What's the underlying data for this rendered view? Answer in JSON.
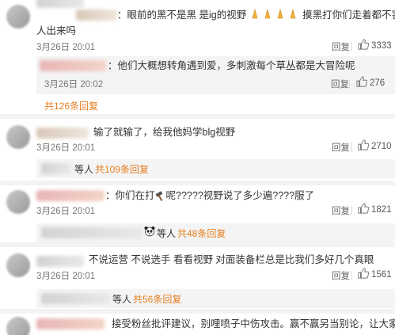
{
  "comments": [
    {
      "text_a": "：眼前的黑不是黑 是ig的视野",
      "text_b": "摸黑打你们走着都不害怕突然冒",
      "text_c": "人出来吗",
      "time": "3月26日 20:01",
      "reply_label": "回复",
      "likes": "3333",
      "sub_reply": {
        "text": "：他们大概想转角遇到爱，多刺激每个草丛都是大冒险呢",
        "time": "3月26日 20:02",
        "reply_label": "回复",
        "likes": "276"
      },
      "more_label": "共126条回复"
    },
    {
      "text": "输了就输了，给我他妈学blg视野",
      "time": "3月26日 20:01",
      "reply_label": "回复",
      "likes": "2710",
      "summary_prefix": "等人",
      "more_label": "共109条回复"
    },
    {
      "text_a": "：你们在打",
      "text_b": "呢?????视野说了多少遍????服了",
      "time": "3月26日 20:01",
      "reply_label": "回复",
      "likes": "1821",
      "summary_prefix": "等人",
      "more_label": "共48条回复"
    },
    {
      "text": "不说运营 不说选手 看看视野 对面装备栏总是比我们多好几个真眼",
      "time": "3月26日 20:01",
      "reply_label": "回复",
      "likes": "1561",
      "summary_prefix": "等人",
      "more_label": "共56条回复"
    },
    {
      "text": "接受粉丝批评建议，别哩喷子中伤攻击。赢不赢另当别论，让大家看到你们在"
    }
  ],
  "colors": {
    "more_link": "#e67e22",
    "background": "#f3f3f3",
    "sub_box": "#f4f4f4"
  },
  "icons": {
    "like": "thumbs-up-icon",
    "emoji": "praying-hands-emoji",
    "hammer": "hammer-emoji",
    "panda": "panda-emoji"
  }
}
